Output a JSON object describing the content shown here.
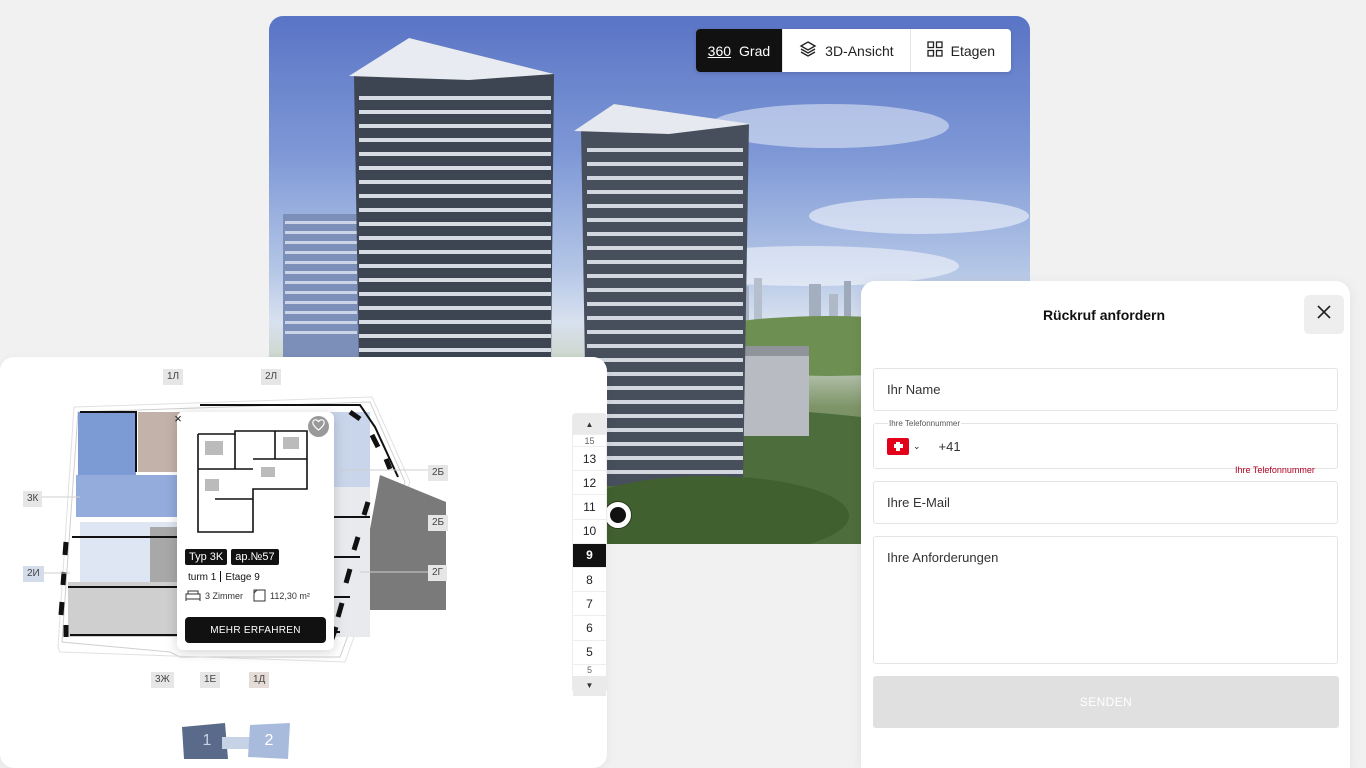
{
  "view_switch": {
    "items": [
      {
        "pre": "360",
        "label": "Grad",
        "icon": null,
        "active": true
      },
      {
        "pre": "",
        "label": "3D-Ansicht",
        "icon": "layers-icon",
        "active": false
      },
      {
        "pre": "",
        "label": "Etagen",
        "icon": "grid-icon",
        "active": false
      }
    ]
  },
  "plan": {
    "section_tags": {
      "t1l": "1Л",
      "t2l": "2Л",
      "t3k": "3К",
      "t2b1": "2Б",
      "t2b2": "2Б",
      "t2i": "2И",
      "t2g": "2Г",
      "t3zh": "3Ж",
      "t1e": "1Е",
      "t1d": "1Д"
    },
    "floors": {
      "partial_top": "15",
      "list": [
        "13",
        "12",
        "11",
        "10",
        "9",
        "8",
        "7",
        "6",
        "5"
      ],
      "partial_bottom": "5",
      "active": "9"
    },
    "popup": {
      "type_badge": "Typ 3K",
      "apt_badge": "ap.№57",
      "tower": "turm 1",
      "floor": "Etage 9",
      "rooms": "3 Zimmer",
      "area": "112,30 m²",
      "more_label": "MEHR ERFAHREN",
      "close_glyph": "×"
    },
    "pager": {
      "page1": "1",
      "page2": "2"
    }
  },
  "form": {
    "title": "Rückruf anfordern",
    "name_placeholder": "Ihr Name",
    "phone_label": "Ihre Telefonnummer",
    "phone_value": "+41",
    "phone_error": "Ihre Telefonnummer",
    "email_placeholder": "Ihre E-Mail",
    "requirements_placeholder": "Ihre Anforderungen",
    "submit_label": "SENDEN"
  },
  "colors": {
    "accent_dark": "#111111",
    "apartment_blue": "#8ea8d8",
    "apartment_brown": "#c9bab2",
    "error": "#b00020"
  }
}
